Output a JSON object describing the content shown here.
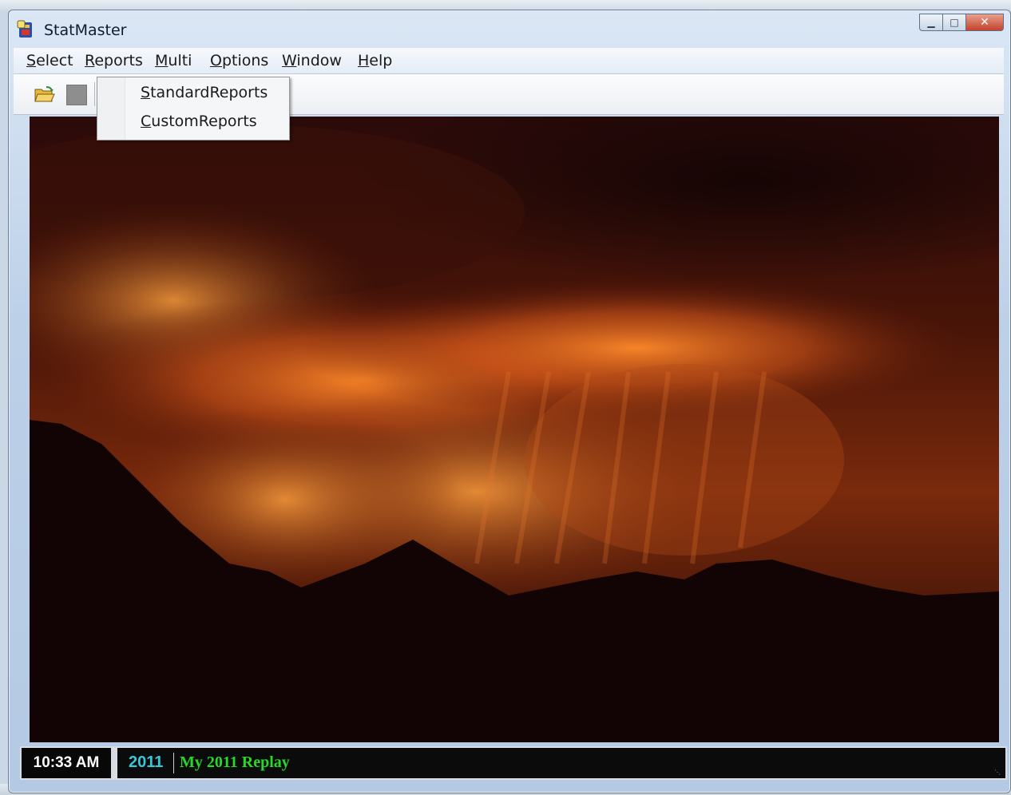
{
  "window": {
    "title": "StatMaster"
  },
  "menubar": {
    "items": [
      {
        "mnemonic": "S",
        "rest": "elect"
      },
      {
        "mnemonic": "R",
        "rest": "eports"
      },
      {
        "mnemonic": "M",
        "rest": "ulti"
      },
      {
        "mnemonic": "O",
        "rest": "ptions"
      },
      {
        "mnemonic": "W",
        "rest": "indow"
      },
      {
        "mnemonic": "H",
        "rest": "elp"
      }
    ]
  },
  "reports_menu": {
    "items": [
      {
        "mnemonic": "S",
        "rest": "tandardReports"
      },
      {
        "mnemonic": "C",
        "rest": "ustomReports"
      }
    ]
  },
  "toolbar": {
    "icons": [
      "open-folder-icon",
      "stop-icon"
    ]
  },
  "status": {
    "time": "10:33 AM",
    "year": "2011",
    "replay_name": "My 2011 Replay",
    "colors": {
      "year": "#38c7d6",
      "replay": "#27d82a"
    }
  }
}
